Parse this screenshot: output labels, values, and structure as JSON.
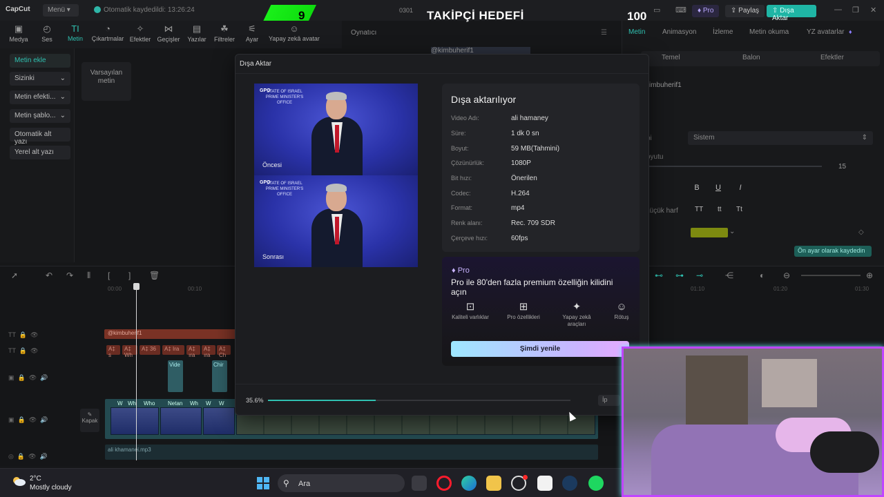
{
  "app": {
    "logo": "CapCut",
    "menu": "Menü",
    "autosave": "Otomatik kaydedildi: 13:26:24",
    "frame": "0301",
    "pro": "Pro",
    "share": "Paylaş",
    "export": "Dışa Aktar"
  },
  "overlay": {
    "left_number": "9",
    "title": "TAKİPÇİ HEDEFİ",
    "right_number": "100",
    "accent": "#1cf51c"
  },
  "toolbar": [
    {
      "label": "Medya",
      "icon": "media-icon"
    },
    {
      "label": "Ses",
      "icon": "audio-icon"
    },
    {
      "label": "Metin",
      "icon": "text-icon"
    },
    {
      "label": "Çıkartmalar",
      "icon": "sticker-icon"
    },
    {
      "label": "Efektler",
      "icon": "effects-icon"
    },
    {
      "label": "Geçişler",
      "icon": "transition-icon"
    },
    {
      "label": "Yazılar",
      "icon": "captions-icon"
    },
    {
      "label": "Filtreler",
      "icon": "filter-icon"
    },
    {
      "label": "Ayar",
      "icon": "adjust-icon"
    },
    {
      "label": "Yapay zekâ avatar",
      "icon": "avatar-icon"
    }
  ],
  "left_panel": {
    "items": [
      "Metin ekle",
      "Sizinki",
      "Metin efekti...",
      "Metin şablo...",
      "Otomatik alt yazı",
      "Yerel alt yazı"
    ],
    "default_card": "Varsayılan metin"
  },
  "player": {
    "title": "Oynatıcı",
    "username": "@kimbuherif1"
  },
  "right_panel": {
    "tabs": [
      "Metin",
      "Animasyon",
      "İzleme",
      "Metin okuma",
      "YZ avatarlar"
    ],
    "subtabs": [
      "Temel",
      "Balon",
      "Efektler"
    ],
    "text_value": "kimbuherif1",
    "font_label": "pi",
    "font_value": "Sistem",
    "size_label": "oyutu",
    "size_value": "15",
    "format": [
      "B",
      "U",
      "I"
    ],
    "case_label": "Küçük harf",
    "case": [
      "TT",
      "tt",
      "Tt"
    ],
    "color": "#7d8a10",
    "save_default": "Ön ayar olarak kaydedin"
  },
  "timeline": {
    "ruler": [
      "00:00",
      "00:10",
      "01:10",
      "01:20",
      "01:30"
    ],
    "text_clip": "@kimbuherif1",
    "sub_clips": [
      "A‡ s",
      "A‡ Wh",
      "A‡ 36",
      "A‡ Ira",
      "A‡ ıra",
      "A‡ ıra",
      "A‡ Ch",
      "A‡ Ne",
      "A‡ ıra"
    ],
    "vid_clips": [
      "Vide",
      "Chir"
    ],
    "main_labels": [
      "W",
      "Wh",
      "Who",
      "Netan",
      "Wh",
      "W",
      "W"
    ],
    "cover": "Kapak",
    "audio": "ali khamanei.mp3"
  },
  "dialog": {
    "title": "Dışa Aktar",
    "before": "Öncesi",
    "after": "Sonrası",
    "preview_logo": "GPO",
    "preview_emblem": "STATE OF ISRAEL PRIME MINISTER'S OFFICE",
    "info_title": "Dışa aktarılıyor",
    "info": [
      {
        "k": "Video Adı:",
        "v": "ali hamaney"
      },
      {
        "k": "Süre:",
        "v": "1 dk 0 sn"
      },
      {
        "k": "Boyut:",
        "v": "59 MB(Tahmini)"
      },
      {
        "k": "Çözünürlük:",
        "v": "1080P"
      },
      {
        "k": "Bit hızı:",
        "v": "Önerilen"
      },
      {
        "k": "Codec:",
        "v": "H.264"
      },
      {
        "k": "Format:",
        "v": "mp4"
      },
      {
        "k": "Renk alanı:",
        "v": "Rec. 709 SDR"
      },
      {
        "k": "Çerçeve hızı:",
        "v": "60fps"
      }
    ],
    "pro_tag": "Pro",
    "pro_headline": "Pro ile 80'den fazla premium özelliğin kilidini açın",
    "features": [
      {
        "label": "Kaliteli varlıklar",
        "icon": "asset-icon"
      },
      {
        "label": "Pro özellikleri",
        "icon": "grid-icon"
      },
      {
        "label": "Yapay zekâ araçları",
        "icon": "magic-wand-icon"
      },
      {
        "label": "Rötuş",
        "icon": "retouch-icon"
      }
    ],
    "upgrade": "Şimdi yenile",
    "progress_text": "35.6%",
    "progress": 0.356,
    "cancel": "İp"
  },
  "taskbar": {
    "temp": "2°C",
    "weather": "Mostly cloudy",
    "search": "Ara",
    "apps": [
      "file-explorer-dark",
      "opera",
      "edge",
      "file-explorer",
      "obs",
      "capcut",
      "steam",
      "spotify"
    ]
  }
}
